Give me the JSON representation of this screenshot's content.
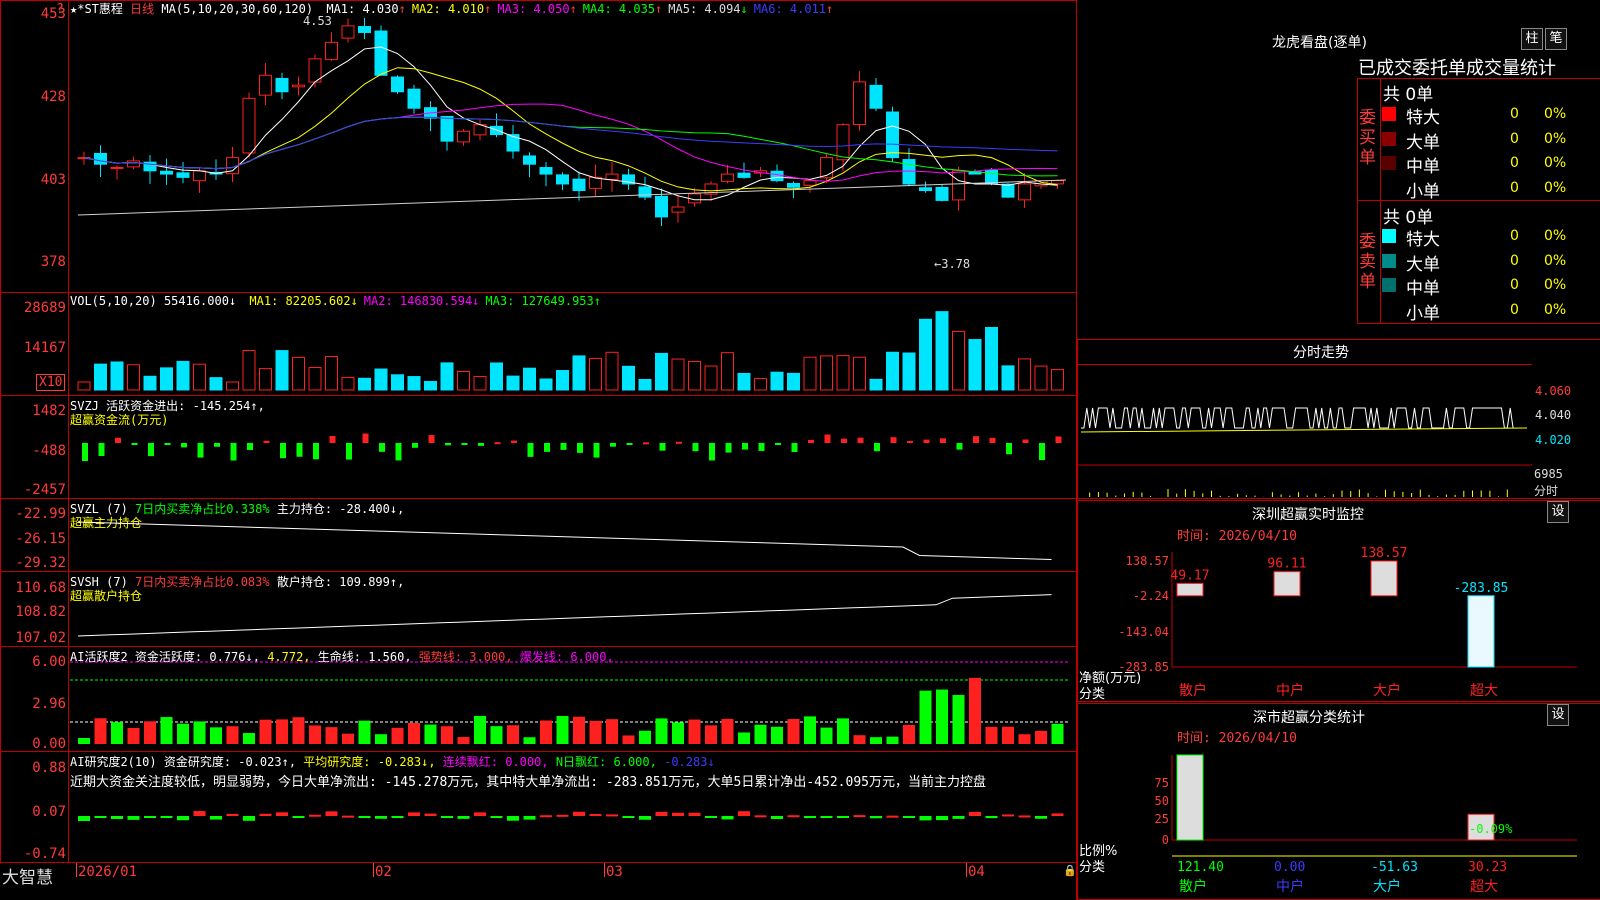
{
  "colors": {
    "up": "#ff2020",
    "down": "#00e5ff",
    "green": "#00ff00",
    "yellow": "#ffff00",
    "magenta": "#ff00ff",
    "white": "#ffffff",
    "blue": "#3c3cff",
    "grid": "#c00000",
    "axis": "#ff3b3b"
  },
  "main": {
    "stock": "★*ST惠程",
    "period": "日线",
    "ma_params": "MA(5,10,20,30,60,120)",
    "ma": [
      {
        "label": "MA1: 4.030",
        "arrow": "↑",
        "color": "#ffffff"
      },
      {
        "label": "MA2: 4.010",
        "arrow": "↑",
        "color": "#ffff00"
      },
      {
        "label": "MA3: 4.050",
        "arrow": "↑",
        "color": "#ff00ff"
      },
      {
        "label": "MA4: 4.035",
        "arrow": "↑",
        "color": "#00ff00"
      },
      {
        "label": "MA5: 4.094",
        "arrow": "↓",
        "color": "#dddddd"
      },
      {
        "label": "MA6: 4.011",
        "arrow": "↑",
        "color": "#3c3cff"
      }
    ],
    "yaxis": [
      "453",
      "428",
      "403",
      "378"
    ],
    "high_mark": "4.53",
    "low_mark": "←3.78"
  },
  "vol": {
    "title": "VOL(5,10,20)",
    "value": "55416.000↓",
    "ma": [
      {
        "label": "MA1: 82205.602↓",
        "color": "#ffff00"
      },
      {
        "label": "MA2: 146830.594↓",
        "color": "#ff00ff"
      },
      {
        "label": "MA3: 127649.953↑",
        "color": "#00ff00"
      }
    ],
    "yaxis": [
      "28689",
      "14167"
    ],
    "unit": "X10"
  },
  "svzj": {
    "title": "SVZJ",
    "desc": "活跃资金进出: -145.254↑,",
    "sub": "超赢资金流(万元)",
    "yaxis": [
      "1482",
      "-488",
      "-2457"
    ]
  },
  "svzl": {
    "title": "SVZL (7)",
    "ratio": "7日内买卖净占比0.338%",
    "hold": "主力持仓: -28.400↓,",
    "sub": "超赢主力持仓",
    "yaxis": [
      "-22.99",
      "-26.15",
      "-29.32"
    ]
  },
  "svsh": {
    "title": "SVSH (7)",
    "ratio": "7日内买卖净占比0.083%",
    "hold": "散户持仓: 109.899↑,",
    "sub": "超赢散户持仓",
    "yaxis": [
      "110.68",
      "108.82",
      "107.02"
    ]
  },
  "ai1": {
    "title": "AI活跃度2",
    "active": "资金活跃度: 0.776↓,",
    "v2": "4.772,",
    "life": "生命线: 1.560,",
    "strong": "强势线: 3.000,",
    "burst": "爆发线: 6.000,",
    "yaxis": [
      "6.00",
      "2.96",
      "0.00"
    ]
  },
  "ai2": {
    "title": "AI研究度2(10)",
    "r1": "资金研究度: -0.023↑,",
    "r2": "平均研究度: -0.283↓,",
    "r3": "连续飘红: 0.000,",
    "r4": "N日飘红: 6.000,",
    "r5": "-0.283↓",
    "comment": "近期大资金关注度较低，明显弱势，今日大单净流出: -145.278万元，其中特大单净流出: -283.851万元，大单5日累计净出-452.095万元，当前主力控盘",
    "yaxis": [
      "0.88",
      "0.07",
      "-0.74"
    ]
  },
  "xaxis": {
    "brand": "大智慧",
    "dates": [
      "2026/01",
      "02",
      "03",
      "04"
    ]
  },
  "dragon": {
    "title": "龙虎看盘(逐单)",
    "btn1": "柱",
    "btn2": "笔",
    "header": "已成交委托单成交量统计",
    "buy": {
      "label": "委买单",
      "total": "共 0单",
      "rows": [
        {
          "name": "特大",
          "v": "0",
          "p": "0%",
          "c": "#ff0000"
        },
        {
          "name": "大单",
          "v": "0",
          "p": "0%",
          "c": "#8b0000"
        },
        {
          "name": "中单",
          "v": "0",
          "p": "0%",
          "c": "#5a0000"
        },
        {
          "name": "小单",
          "v": "0",
          "p": "0%",
          "c": ""
        }
      ]
    },
    "sell": {
      "label": "委卖单",
      "total": "共 0单",
      "rows": [
        {
          "name": "特大",
          "v": "0",
          "p": "0%",
          "c": "#00ffff"
        },
        {
          "name": "大单",
          "v": "0",
          "p": "0%",
          "c": "#008b8b"
        },
        {
          "name": "中单",
          "v": "0",
          "p": "0%",
          "c": "#006f6f"
        },
        {
          "name": "小单",
          "v": "0",
          "p": "0%",
          "c": ""
        }
      ]
    }
  },
  "intraday": {
    "title": "分时走势",
    "prices": [
      "4.060",
      "4.040",
      "4.020"
    ],
    "vol": "6985",
    "vol_unit": "分时"
  },
  "sz_monitor": {
    "title": "深圳超赢实时监控",
    "btn": "设",
    "time": "时间: 2026/04/10",
    "yaxis": [
      "138.57",
      "-2.24",
      "-143.04",
      "-283.85"
    ],
    "ylabel": "净额(万元)",
    "xlabel": "分类",
    "chart_data": {
      "type": "bar",
      "categories": [
        "散户",
        "中户",
        "大户",
        "超大"
      ],
      "values": [
        49.17,
        96.11,
        138.57,
        -283.85
      ],
      "ylim": [
        -283.85,
        138.57
      ]
    }
  },
  "sz_class": {
    "title": "深市超赢分类统计",
    "btn": "设",
    "time": "时间: 2026/04/10",
    "yaxis": [
      "75",
      "50",
      "25",
      "0"
    ],
    "ylabel": "比例%",
    "xlabel": "分类",
    "pct_label": "-0.09%",
    "chart_data": {
      "type": "bar",
      "categories": [
        "散户",
        "中户",
        "大户",
        "超大"
      ],
      "values": [
        121.4,
        0.0,
        -51.63,
        30.23
      ],
      "ylim": [
        0,
        100
      ]
    }
  }
}
